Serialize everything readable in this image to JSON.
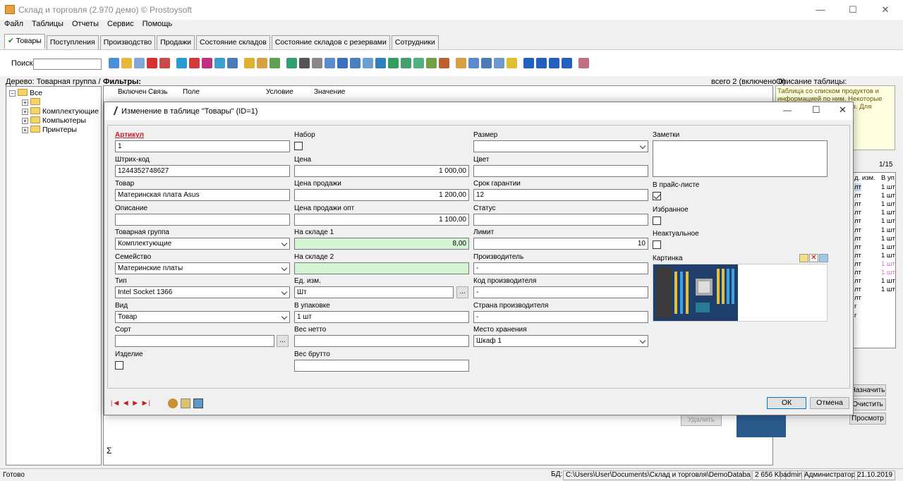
{
  "window": {
    "title": "Склад и торговля (2.970 демо) © Prostoysoft",
    "minimize": "—",
    "maximize": "☐",
    "close": "✕"
  },
  "menu": [
    "Файл",
    "Таблицы",
    "Отчеты",
    "Сервис",
    "Помощь"
  ],
  "tabs": [
    "Товары",
    "Поступления",
    "Производство",
    "Продажи",
    "Состояние складов",
    "Состояние складов с резервами",
    "Сотрудники"
  ],
  "tab_check": "✔",
  "search": {
    "label": "Поиск:",
    "value": ""
  },
  "tree": {
    "label": "Дерево: Товарная группа /",
    "items": [
      "Все",
      "",
      "Комплектующие",
      "Компьютеры",
      "Принтеры"
    ]
  },
  "filters": {
    "label": "Фильтры:",
    "total": "всего 2 (включено 0)",
    "columns": [
      "Включен",
      "Связь",
      "Поле",
      "Условие",
      "Значение"
    ]
  },
  "description": {
    "label": "Описание таблицы:",
    "text": "Таблица со списком продуктов и информацией по ним. Некоторые ...ями ...остоят из ...уктов. Для ...вается его ...поле не"
  },
  "right_grid": {
    "page": "1/15",
    "col1": "д. изм.",
    "col2": "В уп",
    "rows": [
      "лт",
      "лт",
      "лт",
      "лт",
      "лт",
      "лт",
      "лт",
      "лт",
      "лт",
      "лт",
      "лт",
      "лт",
      "лт",
      "лт",
      "г",
      "г"
    ],
    "rows2": [
      "1 шт",
      "1 шт",
      "1 шт",
      "1 шт",
      "1 шт",
      "1 шт",
      "1 шт",
      "1 шт",
      "1 шт",
      "1 шт",
      "1 шт",
      "1 шт",
      "1 шт"
    ]
  },
  "right_buttons": [
    "Назначить",
    "Очистить",
    "Просмотр"
  ],
  "delete_button": "Удалить",
  "sigma": "Σ",
  "status": {
    "ready": "Готово",
    "db_label": "БД:",
    "db_path": "C:\\Users\\User\\Documents\\Склад и торговля\\DemoDatabase.mdb",
    "size": "2 656 Kb",
    "user": "admin",
    "role": "Администратор",
    "date": "21.10.2019"
  },
  "dialog": {
    "title": "Изменение в таблице \"Товары\" (ID=1)",
    "fields": {
      "article": {
        "label": "Артикул",
        "value": "1"
      },
      "barcode": {
        "label": "Штрих-код",
        "value": "1244352748627"
      },
      "product": {
        "label": "Товар",
        "value": "Материнская плата Asus"
      },
      "description": {
        "label": "Описание",
        "value": ""
      },
      "group": {
        "label": "Товарная группа",
        "value": "Комплектующие"
      },
      "family": {
        "label": "Семейство",
        "value": "Материнские платы"
      },
      "type": {
        "label": "Тип",
        "value": "Intel Socket 1366"
      },
      "kind": {
        "label": "Вид",
        "value": "Товар"
      },
      "sort": {
        "label": "Сорт",
        "value": ""
      },
      "item": {
        "label": "Изделие"
      },
      "set": {
        "label": "Набор"
      },
      "price": {
        "label": "Цена",
        "value": "1 000,00"
      },
      "sale_price": {
        "label": "Цена продажи",
        "value": "1 200,00"
      },
      "wholesale_price": {
        "label": "Цена продажи опт",
        "value": "1 100,00"
      },
      "stock1": {
        "label": "На складе 1",
        "value": "8,00"
      },
      "stock2": {
        "label": "На складе 2",
        "value": ""
      },
      "unit": {
        "label": "Ед. изм.",
        "value": "Шт"
      },
      "pack": {
        "label": "В упаковке",
        "value": "1 шт"
      },
      "net_weight": {
        "label": "Вес нетто",
        "value": ""
      },
      "gross_weight": {
        "label": "Вес брутто",
        "value": ""
      },
      "size": {
        "label": "Размер",
        "value": ""
      },
      "color": {
        "label": "Цвет",
        "value": ""
      },
      "warranty": {
        "label": "Срок гарантии",
        "value": "12"
      },
      "status": {
        "label": "Статус",
        "value": ""
      },
      "limit": {
        "label": "Лимит",
        "value": "10"
      },
      "manufacturer": {
        "label": "Производитель",
        "value": "-"
      },
      "manufacturer_code": {
        "label": "Код производителя",
        "value": "-"
      },
      "country": {
        "label": "Страна производителя",
        "value": "-"
      },
      "location": {
        "label": "Место хранения",
        "value": "Шкаф 1"
      },
      "notes": {
        "label": "Заметки",
        "value": ""
      },
      "in_pricelist": {
        "label": "В прайс-листе",
        "checked": true
      },
      "favorite": {
        "label": "Избранное",
        "checked": false
      },
      "obsolete": {
        "label": "Неактуальное",
        "checked": false
      },
      "picture": {
        "label": "Картинка"
      }
    },
    "dots": "...",
    "ok": "ОК",
    "cancel": "Отмена"
  }
}
